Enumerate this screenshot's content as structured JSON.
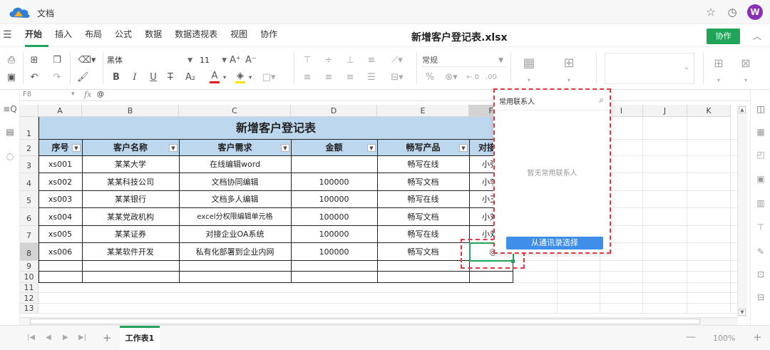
{
  "app": {
    "name": "文档",
    "avatar_letter": "W"
  },
  "menu": {
    "tabs": [
      "开始",
      "插入",
      "布局",
      "公式",
      "数据",
      "数据透视表",
      "视图",
      "协作"
    ],
    "active_index": 0,
    "doc_title": "新增客户登记表.xlsx",
    "collab_label": "协作"
  },
  "toolbar": {
    "font_name": "黑体",
    "font_size": "11",
    "number_format": "常规",
    "bold": "B",
    "italic": "I",
    "underline": "U",
    "strike": "T",
    "grow_font": "A⁺",
    "shrink_font": "A⁻",
    "superscript": "A₂",
    "font_color": "A",
    "percent": "%"
  },
  "formula": {
    "cell_ref": "F8",
    "fx": "fx",
    "value": "@"
  },
  "columns": [
    "A",
    "B",
    "C",
    "D",
    "E",
    "F",
    "G",
    "H",
    "I",
    "J",
    "K"
  ],
  "rows": [
    "1",
    "2",
    "3",
    "4",
    "5",
    "6",
    "7",
    "8",
    "9",
    "10",
    "11",
    "12",
    "13"
  ],
  "sheet": {
    "title": "新增客户登记表",
    "headers": [
      "序号",
      "客户名称",
      "客户需求",
      "金额",
      "畅写产品",
      "对接销"
    ],
    "data": [
      [
        "xs001",
        "某某大学",
        "在线编辑word",
        "",
        "畅写在线",
        "小张"
      ],
      [
        "xs002",
        "某某科技公司",
        "文档协同编辑",
        "100000",
        "畅写文档",
        "小李"
      ],
      [
        "xs003",
        "某某银行",
        "文档多人编辑",
        "100000",
        "畅写在线",
        "小王"
      ],
      [
        "xs004",
        "某某党政机构",
        "excel分权限编辑单元格",
        "100000",
        "畅写文档",
        "小刘"
      ],
      [
        "xs005",
        "某某证券",
        "对接企业OA系统",
        "100000",
        "畅写在线",
        "小刘"
      ],
      [
        "xs006",
        "某某软件开发",
        "私有化部署到企业内网",
        "100000",
        "畅写文档",
        "@"
      ]
    ]
  },
  "popup": {
    "title": "常用联系人",
    "empty_text": "暂无常用联系人",
    "button_label": "从通讯录选择"
  },
  "bottom": {
    "sheet_tab": "工作表1",
    "zoom": "100%"
  },
  "colors": {
    "accent": "#1fa45a",
    "header_fill": "#bdd7ee",
    "highlight": "#e0383e",
    "popup_button": "#3f8ee8"
  }
}
